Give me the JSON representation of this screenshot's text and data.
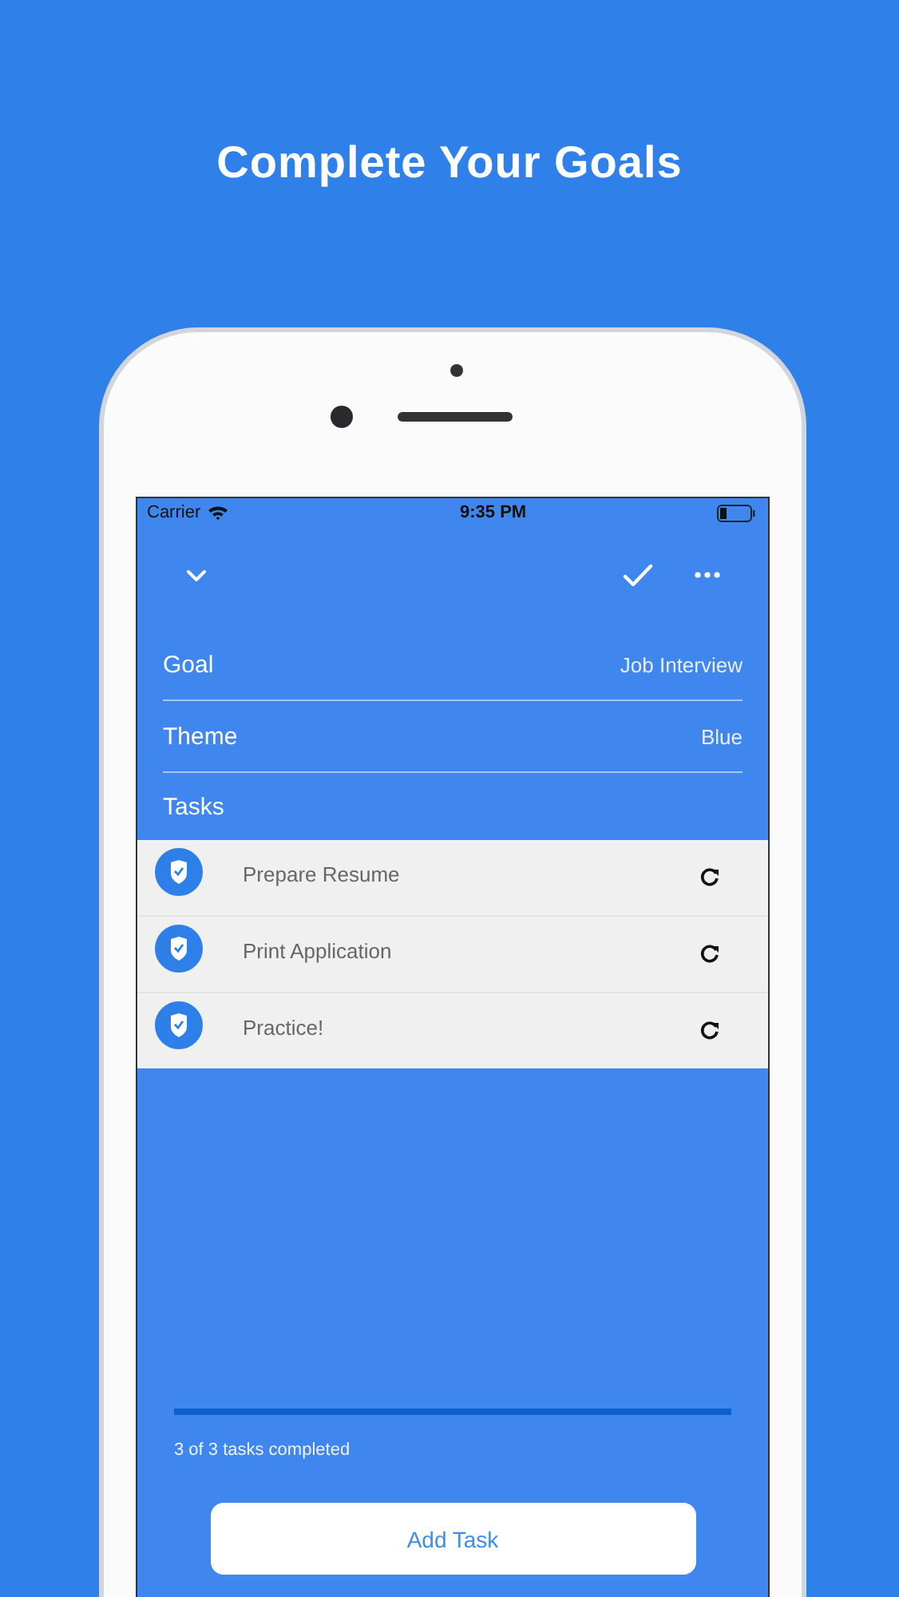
{
  "title": "Complete Your Goals",
  "status_bar": {
    "carrier": "Carrier",
    "time": "9:35 PM"
  },
  "fields": [
    {
      "label": "Goal",
      "value": "Job Interview"
    },
    {
      "label": "Theme",
      "value": "Blue"
    }
  ],
  "tasks_label": "Tasks",
  "tasks": [
    {
      "name": "Prepare Resume",
      "checked": true
    },
    {
      "name": "Print Application",
      "checked": true
    },
    {
      "name": "Practice!",
      "checked": true
    }
  ],
  "progress": {
    "level": 1,
    "text": "3 of 3 tasks completed"
  },
  "add_button": "Add Task"
}
